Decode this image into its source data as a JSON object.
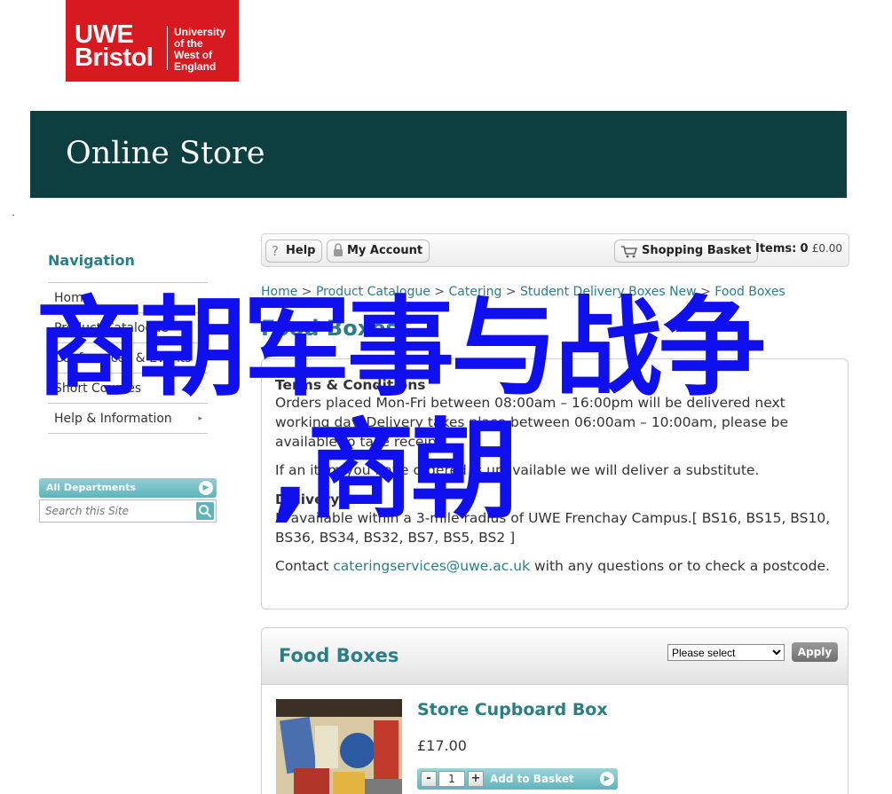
{
  "logo": {
    "line1": "UWE",
    "line2": "Bristol",
    "univ_lines": [
      "University",
      "of the",
      "West of",
      "England"
    ]
  },
  "banner": {
    "title": "Online Store"
  },
  "nav": {
    "heading": "Navigation",
    "items": [
      {
        "label": "Home",
        "has_arrow": false
      },
      {
        "label": "Product Catalogue",
        "has_arrow": true
      },
      {
        "label": "Conferences & Events",
        "has_arrow": true
      },
      {
        "label": "Short Courses",
        "has_arrow": false
      },
      {
        "label": "Help & Information",
        "has_arrow": true
      }
    ]
  },
  "search": {
    "departments_label": "All Departments",
    "placeholder": "Search this Site"
  },
  "toolbar": {
    "help": "Help",
    "account": "My Account",
    "basket": "Shopping Basket",
    "items_label": "Items:",
    "items_count": "0",
    "items_amount": "£0.00"
  },
  "breadcrumb": [
    "Home",
    "Product Catalogue",
    "Catering",
    "Student Delivery Boxes New",
    "Food Boxes"
  ],
  "info": {
    "title": "Food Boxes",
    "terms_heading": "Terms & Conditions",
    "terms_text": "Orders placed Mon-Fri between 08:00am – 16:00pm will be delivered next working day. Delivery takes place between 06:00am – 10:00am, please be available to take receipt.",
    "substitute_text": "If an item you have ordered is unavailable we will deliver a substitute.",
    "delivery_heading": "Delivery",
    "delivery_text": "Is available within a 3-mile radius of UWE Frenchay Campus.[ BS16, BS15, BS10, BS36, BS34, BS32, BS7, BS5, BS2 ]",
    "contact_prefix": "Contact ",
    "contact_email": "cateringservices@uwe.ac.uk",
    "contact_suffix": " with any questions or to check a postcode."
  },
  "food_boxes": {
    "title": "Food Boxes",
    "select_value": "Please select",
    "apply_label": "Apply",
    "product": {
      "name": "Store Cupboard Box",
      "price": "£17.00",
      "quantity": "1",
      "add_label": "Add to Basket"
    }
  },
  "overlay": {
    "line1": "商朝军事与战争",
    "line2": ",商朝"
  },
  "colors": {
    "brand_red": "#d71920",
    "banner": "#0d3f41",
    "accent": "#2a7e86",
    "overlay": "#1010ee"
  }
}
